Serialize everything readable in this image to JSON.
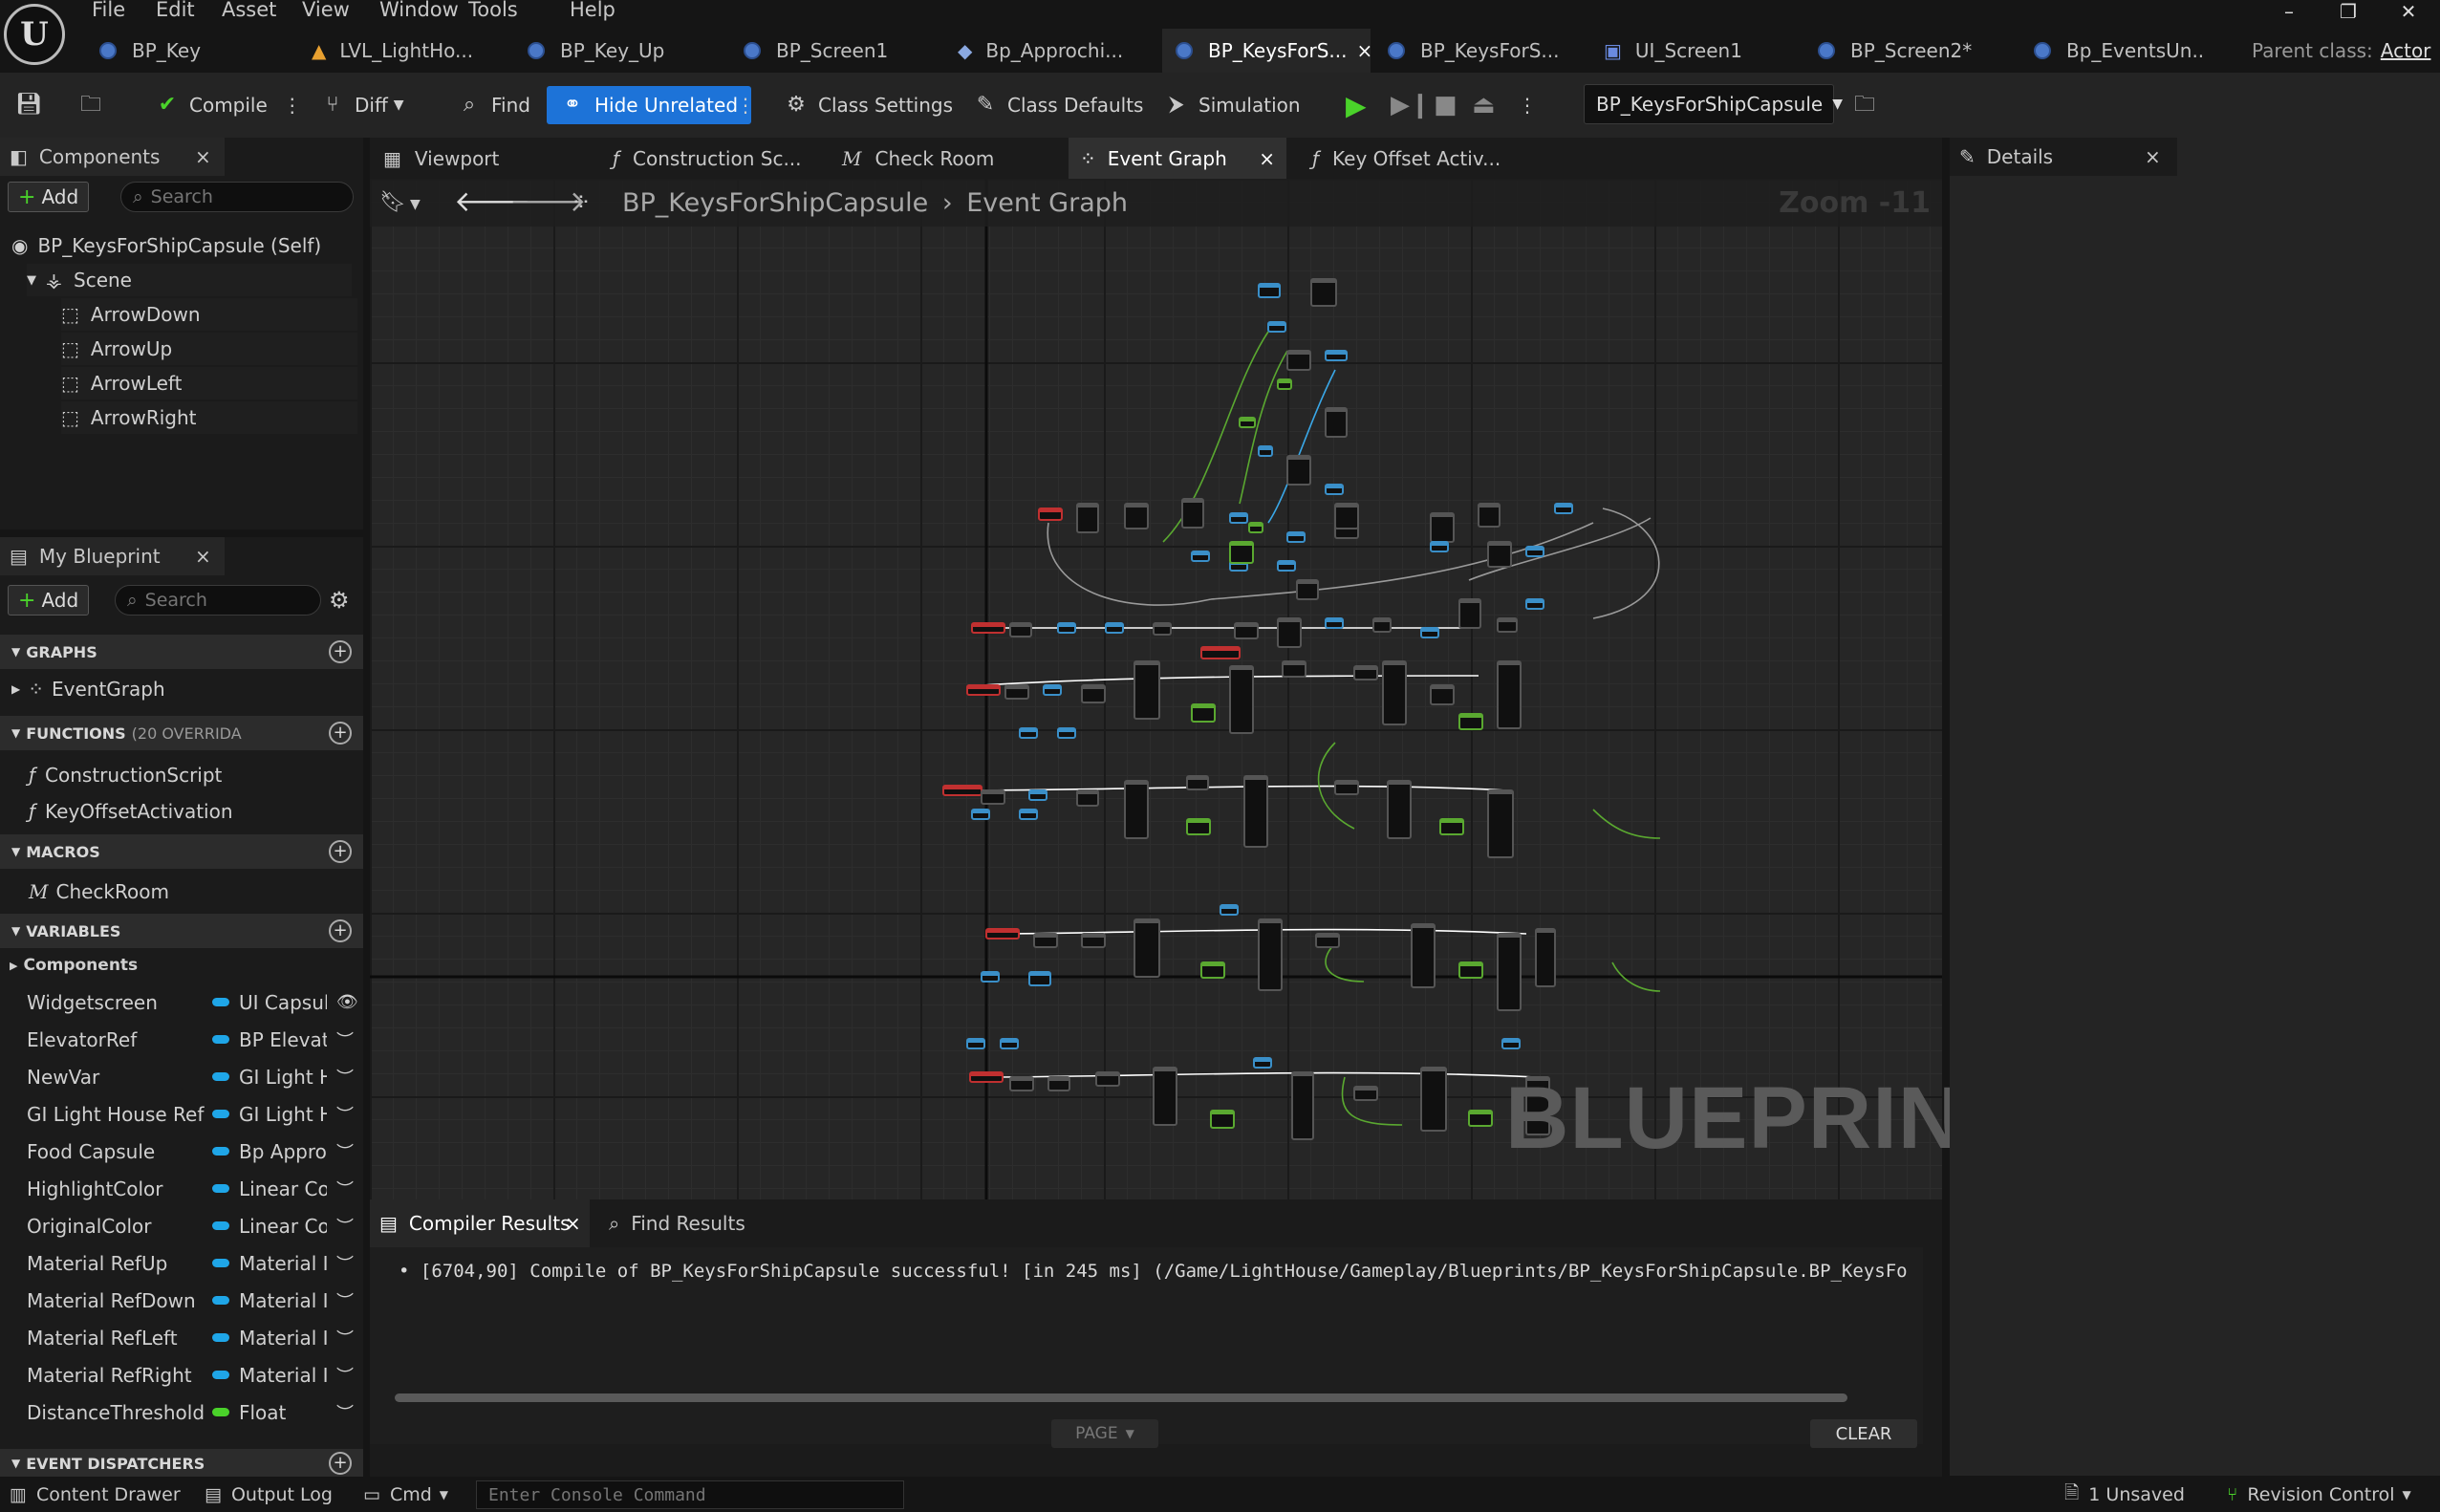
{
  "menu": {
    "items": [
      "File",
      "Edit",
      "Asset",
      "View",
      "Window",
      "Tools",
      "Help"
    ]
  },
  "doc_tabs": [
    "BP_Key",
    "LVL_LightHo...",
    "BP_Key_Up",
    "BP_Screen1",
    "Bp_Approchi...",
    "BP_KeysForS...",
    "BP_KeysForS...",
    "UI_Screen1",
    "BP_Screen2*",
    "Bp_EventsUn..."
  ],
  "parent_class": {
    "label": "Parent class:",
    "value": "Actor"
  },
  "toolbar": {
    "compile": "Compile",
    "diff": "Diff",
    "find": "Find",
    "hide_unrelated": "Hide Unrelated",
    "class_settings": "Class Settings",
    "class_defaults": "Class Defaults",
    "simulation": "Simulation",
    "debug_object": "BP_KeysForShipCapsule"
  },
  "components": {
    "title": "Components",
    "add": "Add",
    "search_placeholder": "Search",
    "self": "BP_KeysForShipCapsule (Self)",
    "scene": "Scene",
    "children": [
      "ArrowDown",
      "ArrowUp",
      "ArrowLeft",
      "ArrowRight"
    ]
  },
  "my_blueprint": {
    "title": "My Blueprint",
    "add": "Add",
    "search_placeholder": "Search",
    "graphs_header": "GRAPHS",
    "graphs": [
      "EventGraph"
    ],
    "functions_header": "FUNCTIONS",
    "functions_note": "(20 OVERRIDA",
    "functions": [
      "ConstructionScript",
      "KeyOffsetActivation"
    ],
    "macros_header": "MACROS",
    "macros": [
      "CheckRoom"
    ],
    "variables_header": "VARIABLES",
    "components_group": "Components",
    "variables": [
      {
        "name": "Widgetscreen",
        "type": "UI Capsule",
        "color": "#1fa6e8"
      },
      {
        "name": "ElevatorRef",
        "type": "BP Elevator",
        "color": "#1fa6e8"
      },
      {
        "name": "NewVar",
        "type": "GI Light House",
        "color": "#1fa6e8"
      },
      {
        "name": "GI Light House Ref",
        "type": "GI Light House",
        "color": "#1fa6e8"
      },
      {
        "name": "Food Capsule",
        "type": "Bp Approching",
        "color": "#1fa6e8"
      },
      {
        "name": "HighlightColor",
        "type": "Linear Color",
        "color": "#1fa6e8"
      },
      {
        "name": "OriginalColor",
        "type": "Linear Color",
        "color": "#1fa6e8"
      },
      {
        "name": "Material RefUp",
        "type": "Material Instance",
        "color": "#1fa6e8"
      },
      {
        "name": "Material RefDown",
        "type": "Material Instance",
        "color": "#1fa6e8"
      },
      {
        "name": "Material RefLeft",
        "type": "Material Instance",
        "color": "#1fa6e8"
      },
      {
        "name": "Material RefRight",
        "type": "Material Instance",
        "color": "#1fa6e8"
      },
      {
        "name": "DistanceThreshold",
        "type": "Float",
        "color": "#4ad22a"
      }
    ],
    "event_dispatchers_header": "EVENT DISPATCHERS"
  },
  "graph_tabs": [
    "Viewport",
    "Construction Sc...",
    "Check Room",
    "Event Graph",
    "Key Offset Activ..."
  ],
  "breadcrumb": {
    "blueprint": "BP_KeysForShipCapsule",
    "graph": "Event Graph"
  },
  "zoom": "Zoom -11",
  "watermark": "BLUEPRINT",
  "details": {
    "title": "Details"
  },
  "bottom_tabs": {
    "compiler_results": "Compiler Results",
    "find_results": "Find Results"
  },
  "compiler_message": "[6704,90] Compile of BP_KeysForShipCapsule successful! [in 245 ms] (/Game/LightHouse/Gameplay/Blueprints/BP_KeysForShipCapsule.BP_KeysForShipC",
  "page_button": "PAGE",
  "clear_button": "CLEAR",
  "statusbar": {
    "content_drawer": "Content Drawer",
    "output_log": "Output Log",
    "cmd": "Cmd",
    "console_placeholder": "Enter Console Command",
    "unsaved": "1 Unsaved",
    "revision_control": "Revision Control"
  }
}
